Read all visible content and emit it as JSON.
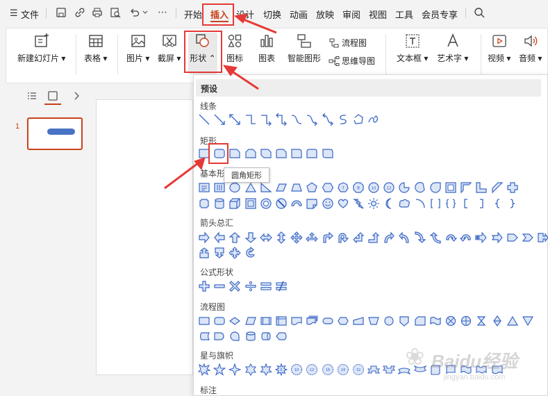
{
  "menubar": {
    "file_label": "文件",
    "tabs": [
      "开始",
      "插入",
      "设计",
      "切换",
      "动画",
      "放映",
      "审阅",
      "视图",
      "工具",
      "会员专享"
    ]
  },
  "ribbon": {
    "new_slide": "新建幻灯片",
    "table": "表格",
    "picture": "图片",
    "screenshot": "截屏",
    "shape": "形状",
    "icon": "图标",
    "chart": "图表",
    "smart_shape": "智能图形",
    "flowchart": "流程图",
    "mindmap": "思维导图",
    "textbox": "文本框",
    "wordart": "艺术字",
    "video": "视频",
    "audio": "音频"
  },
  "slides": {
    "number": "1"
  },
  "shapes_panel": {
    "preset": "预设",
    "lines": "线条",
    "rectangles": "矩形",
    "basic": "基本形",
    "arrows": "箭头总汇",
    "formula": "公式形状",
    "flowchart": "流程图",
    "stars": "星与旗帜",
    "callouts": "标注",
    "tooltip": "圆角矩形"
  },
  "watermark": {
    "text": "Baidu经验",
    "url": "jingyan.baidu.com"
  },
  "colors": {
    "accent": "#c8421a",
    "icon_blue": "#3a66c4",
    "highlight_red": "#e53935"
  }
}
